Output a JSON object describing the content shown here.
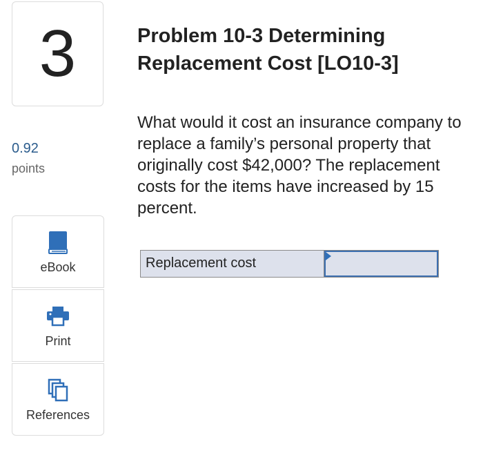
{
  "question": {
    "number": "3",
    "points_value": "0.92",
    "points_label": "points",
    "title": "Problem 10-3 Determining Replacement Cost [LO10-3]",
    "text": "What would it cost an insurance company to replace a family’s personal property that originally cost $42,000? The replacement costs for the items have increased by 15 percent."
  },
  "tools": [
    {
      "label": "eBook",
      "icon": "book-icon"
    },
    {
      "label": "Print",
      "icon": "printer-icon"
    },
    {
      "label": "References",
      "icon": "references-icon"
    }
  ],
  "answer": {
    "label": "Replacement cost",
    "value": ""
  },
  "colors": {
    "accent": "#2a5b8c",
    "icon": "#2f6fb8",
    "answer_bg": "#dde1ec",
    "input_border": "#3c6fb0"
  }
}
